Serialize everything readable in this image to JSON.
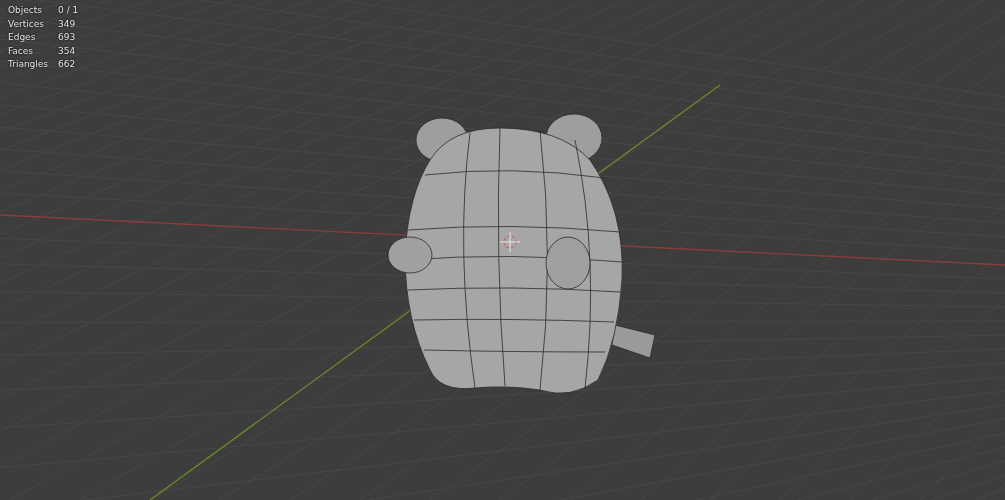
{
  "statistics": [
    {
      "label": "Objects",
      "value": "0 / 1"
    },
    {
      "label": "Vertices",
      "value": "349"
    },
    {
      "label": "Edges",
      "value": "693"
    },
    {
      "label": "Faces",
      "value": "354"
    },
    {
      "label": "Triangles",
      "value": "662"
    }
  ]
}
